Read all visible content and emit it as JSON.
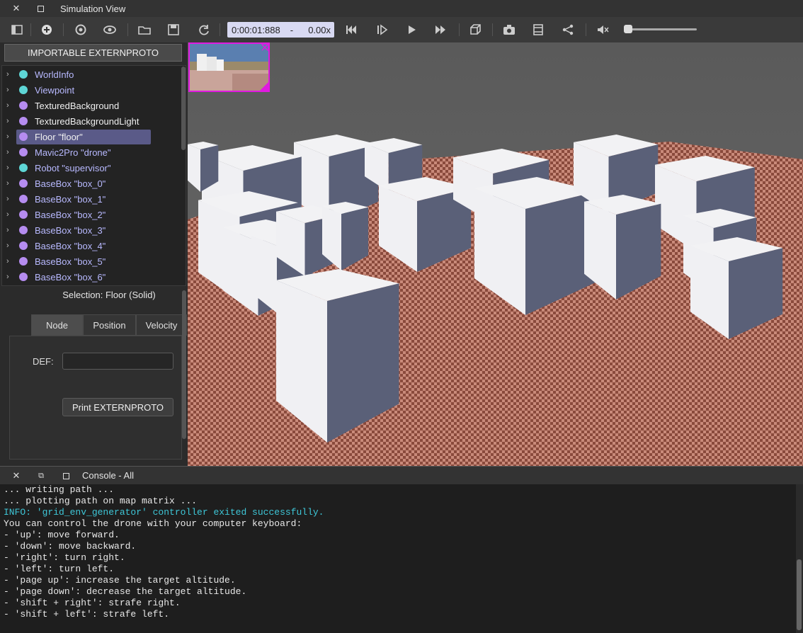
{
  "window": {
    "title": "Simulation View"
  },
  "toolbar": {
    "time": "0:00:01:888",
    "separator": "-",
    "speed": "0.00x",
    "icons": [
      "toggle-scene-tree-icon",
      "add-node-icon",
      "reload-icon",
      "view-icon",
      "open-file-icon",
      "save-icon",
      "reset-simulation-icon",
      "step-back-icon",
      "step-icon",
      "play-icon",
      "fast-forward-icon",
      "view-3d-icon",
      "screenshot-icon",
      "record-movie-icon",
      "share-icon",
      "mute-icon"
    ],
    "volume": 0.0
  },
  "left_panel": {
    "importable_button": "IMPORTABLE EXTERNPROTO",
    "tree": [
      {
        "label": "WorldInfo",
        "color": "#5ed6d6",
        "text_color": "#b8b9ff"
      },
      {
        "label": "Viewpoint",
        "color": "#5ed6d6",
        "text_color": "#b8b9ff"
      },
      {
        "label": "TexturedBackground",
        "color": "#b58cf0",
        "text_color": "#f0f0f0"
      },
      {
        "label": "TexturedBackgroundLight",
        "color": "#b58cf0",
        "text_color": "#f0f0f0"
      },
      {
        "label": "Floor \"floor\"",
        "color": "#b58cf0",
        "text_color": "#f0f0f0",
        "selected": true
      },
      {
        "label": "Mavic2Pro \"drone\"",
        "color": "#b58cf0",
        "text_color": "#b8b9ff"
      },
      {
        "label": "Robot \"supervisor\"",
        "color": "#5ed6d6",
        "text_color": "#b8b9ff"
      },
      {
        "label": "BaseBox \"box_0\"",
        "color": "#b58cf0",
        "text_color": "#b8b9ff"
      },
      {
        "label": "BaseBox \"box_1\"",
        "color": "#b58cf0",
        "text_color": "#b8b9ff"
      },
      {
        "label": "BaseBox \"box_2\"",
        "color": "#b58cf0",
        "text_color": "#b8b9ff"
      },
      {
        "label": "BaseBox \"box_3\"",
        "color": "#b58cf0",
        "text_color": "#b8b9ff"
      },
      {
        "label": "BaseBox \"box_4\"",
        "color": "#b58cf0",
        "text_color": "#b8b9ff"
      },
      {
        "label": "BaseBox \"box_5\"",
        "color": "#b58cf0",
        "text_color": "#b8b9ff"
      },
      {
        "label": "BaseBox \"box_6\"",
        "color": "#b58cf0",
        "text_color": "#b8b9ff"
      }
    ],
    "selection": "Selection: Floor (Solid)",
    "tabs": [
      "Node",
      "Position",
      "Velocity"
    ],
    "def_label": "DEF:",
    "def_value": "",
    "print_button": "Print EXTERNPROTO"
  },
  "console": {
    "title": "Console - All",
    "lines": [
      {
        "text": "... writing path ...",
        "type": "normal"
      },
      {
        "text": "... plotting path on map matrix ...",
        "type": "normal"
      },
      {
        "text": "INFO: 'grid_env_generator' controller exited successfully.",
        "type": "info"
      },
      {
        "text": "You can control the drone with your computer keyboard:",
        "type": "normal"
      },
      {
        "text": "- 'up': move forward.",
        "type": "normal"
      },
      {
        "text": "- 'down': move backward.",
        "type": "normal"
      },
      {
        "text": "- 'right': turn right.",
        "type": "normal"
      },
      {
        "text": "- 'left': turn left.",
        "type": "normal"
      },
      {
        "text": "- 'page up': increase the target altitude.",
        "type": "normal"
      },
      {
        "text": "- 'page down': decrease the target altitude.",
        "type": "normal"
      },
      {
        "text": "- 'shift + right': strafe right.",
        "type": "normal"
      },
      {
        "text": "- 'shift + left': strafe left.",
        "type": "normal"
      }
    ]
  },
  "colors": {
    "accent_selection": "#5a5a88",
    "overlay_border": "#e01ae0",
    "floor_a": "#c98a7a",
    "floor_b": "#8a4a3c",
    "box_top": "#f2f2f4",
    "box_side": "#5a6078"
  }
}
